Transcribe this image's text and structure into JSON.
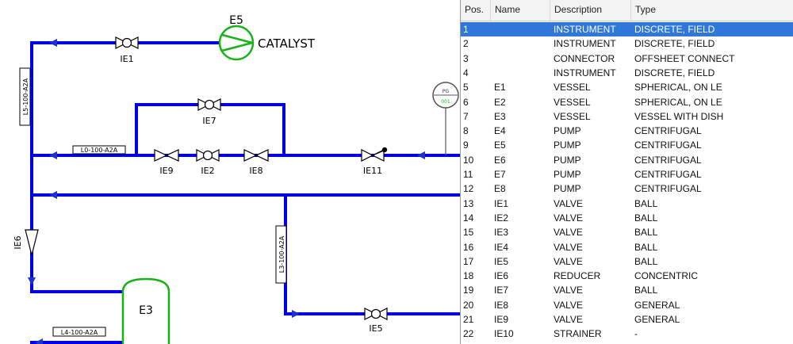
{
  "diagram": {
    "labels": {
      "e5": "E5",
      "catalyst": "CATALYST",
      "e3": "E3",
      "ie1": "IE1",
      "ie7": "IE7",
      "ie9": "IE9",
      "ie2": "IE2",
      "ie8": "IE8",
      "ie11": "IE11",
      "ie6": "IE6",
      "ie5": "IE5",
      "line_l5": "L5-100-A2A",
      "line_l0": "L0-100-A2A",
      "line_l3": "L3-100-A2A",
      "line_l4": "L4-100-A2A",
      "pg_top": "PG",
      "pg_bottom": "001"
    },
    "colors": {
      "line": "#0000e6",
      "equipment": "#19b219",
      "instrument": "#666666",
      "flow_arrow": "#1a33cc"
    }
  },
  "grid": {
    "columns": [
      "Pos.",
      "Name",
      "Description",
      "Type"
    ],
    "selected_row": 0,
    "rows": [
      {
        "pos": "1",
        "name": "",
        "desc": "INSTRUMENT",
        "type": "DISCRETE, FIELD"
      },
      {
        "pos": "2",
        "name": "",
        "desc": "INSTRUMENT",
        "type": "DISCRETE, FIELD"
      },
      {
        "pos": "3",
        "name": "",
        "desc": "CONNECTOR",
        "type": "OFFSHEET CONNECT"
      },
      {
        "pos": "4",
        "name": "",
        "desc": "INSTRUMENT",
        "type": "DISCRETE, FIELD"
      },
      {
        "pos": "5",
        "name": "E1",
        "desc": "VESSEL",
        "type": "SPHERICAL, ON LE"
      },
      {
        "pos": "6",
        "name": "E2",
        "desc": "VESSEL",
        "type": "SPHERICAL, ON LE"
      },
      {
        "pos": "7",
        "name": "E3",
        "desc": "VESSEL",
        "type": "VESSEL WITH DISH"
      },
      {
        "pos": "8",
        "name": "E4",
        "desc": "PUMP",
        "type": "CENTRIFUGAL"
      },
      {
        "pos": "9",
        "name": "E5",
        "desc": "PUMP",
        "type": "CENTRIFUGAL"
      },
      {
        "pos": "10",
        "name": "E6",
        "desc": "PUMP",
        "type": "CENTRIFUGAL"
      },
      {
        "pos": "11",
        "name": "E7",
        "desc": "PUMP",
        "type": "CENTRIFUGAL"
      },
      {
        "pos": "12",
        "name": "E8",
        "desc": "PUMP",
        "type": "CENTRIFUGAL"
      },
      {
        "pos": "13",
        "name": "IE1",
        "desc": "VALVE",
        "type": "BALL"
      },
      {
        "pos": "14",
        "name": "IE2",
        "desc": "VALVE",
        "type": "BALL"
      },
      {
        "pos": "15",
        "name": "IE3",
        "desc": "VALVE",
        "type": "BALL"
      },
      {
        "pos": "16",
        "name": "IE4",
        "desc": "VALVE",
        "type": "BALL"
      },
      {
        "pos": "17",
        "name": "IE5",
        "desc": "VALVE",
        "type": "BALL"
      },
      {
        "pos": "18",
        "name": "IE6",
        "desc": "REDUCER",
        "type": "CONCENTRIC"
      },
      {
        "pos": "19",
        "name": "IE7",
        "desc": "VALVE",
        "type": "BALL"
      },
      {
        "pos": "20",
        "name": "IE8",
        "desc": "VALVE",
        "type": "GENERAL"
      },
      {
        "pos": "21",
        "name": "IE9",
        "desc": "VALVE",
        "type": "GENERAL"
      },
      {
        "pos": "22",
        "name": "IE10",
        "desc": "STRAINER",
        "type": "-"
      }
    ]
  }
}
